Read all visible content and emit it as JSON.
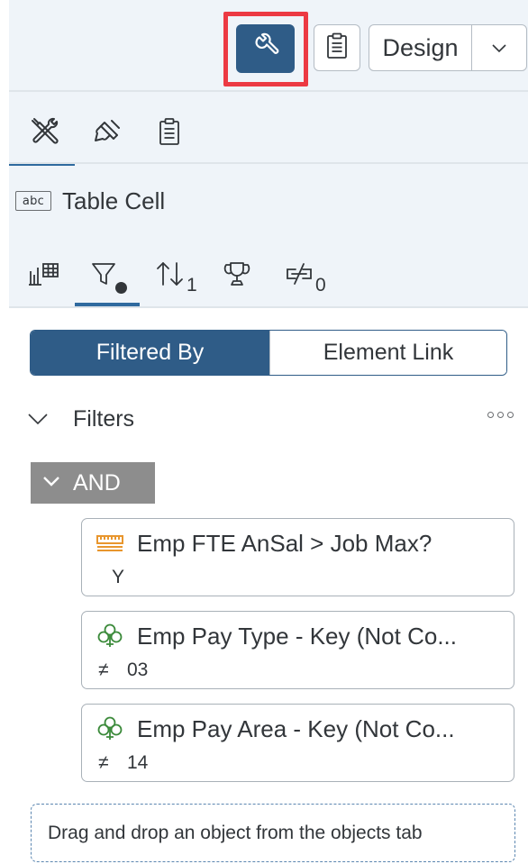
{
  "toolbar": {
    "tools_icon": "wrench-icon",
    "clipboard_icon": "clipboard-icon",
    "mode_select": {
      "value": "Design",
      "icon": "chevron-down-icon"
    },
    "highlight_color": "#ec3a43"
  },
  "main_tabs": [
    {
      "icon": "tools-icon",
      "selected": true
    },
    {
      "icon": "paint-brush-icon",
      "selected": false
    },
    {
      "icon": "clipboard-icon",
      "selected": false
    }
  ],
  "object": {
    "type_icon": "abc-icon",
    "type_icon_text": "abc",
    "label": "Table Cell"
  },
  "sub_tabs": [
    {
      "icon": "bar-chart-table-icon",
      "badge": "",
      "selected": false
    },
    {
      "icon": "filter-icon",
      "badge": "dot",
      "selected": true
    },
    {
      "icon": "sort-icon",
      "badge": "1",
      "selected": false
    },
    {
      "icon": "trophy-icon",
      "badge": "",
      "selected": false
    },
    {
      "icon": "no-link-icon",
      "badge": "0",
      "selected": false
    }
  ],
  "segmented": {
    "options": [
      "Filtered By",
      "Element Link"
    ],
    "selected": 0
  },
  "filters": {
    "title": "Filters",
    "group_operator": "AND",
    "items": [
      {
        "icon": "ruler-measure-icon",
        "label": "Emp FTE AnSal  >  Job Max?",
        "operator": "",
        "value": "Y"
      },
      {
        "icon": "dimension-icon",
        "label": "Emp Pay Type - Key (Not Co...",
        "operator": "≠",
        "value": "03"
      },
      {
        "icon": "dimension-icon",
        "label": "Emp Pay Area - Key (Not Co...",
        "operator": "≠",
        "value": "14"
      }
    ]
  },
  "dropzone": {
    "text": "Drag and drop an object from the objects tab"
  },
  "colors": {
    "accent": "#2f5c87",
    "panel_bg": "#eff4f9",
    "and_chip": "#8d8d8d",
    "measure_icon": "#e8962e",
    "dimension_icon": "#3b8a3a"
  }
}
